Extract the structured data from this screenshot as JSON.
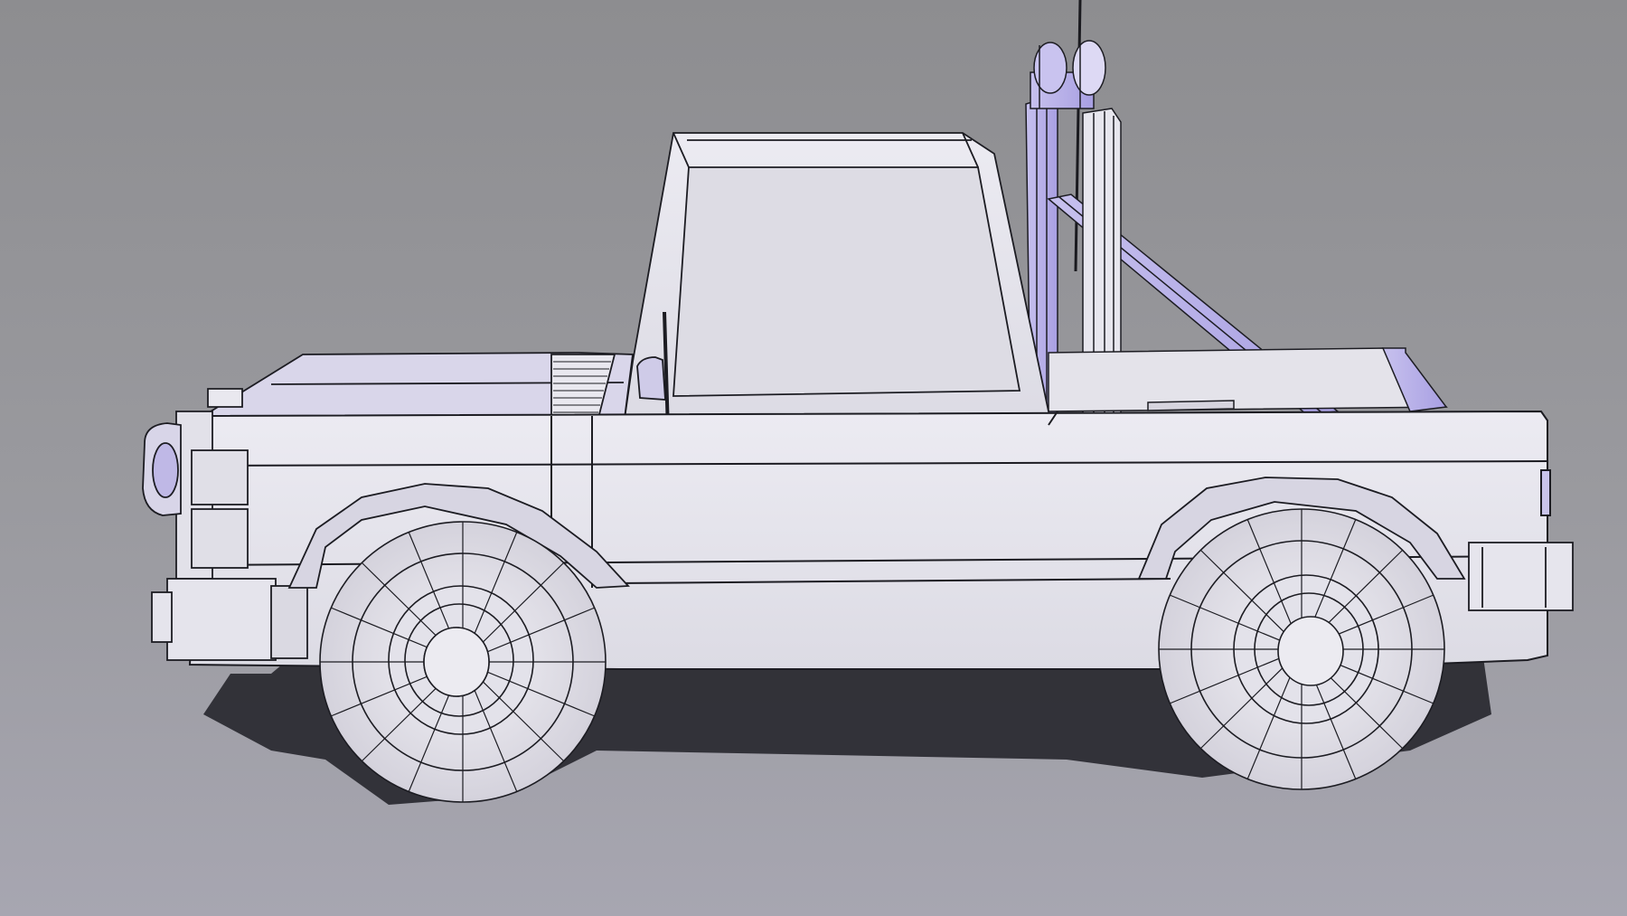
{
  "scene": {
    "subject": "pickup-truck-wireframe",
    "colors": {
      "background_top": "#8e8e92",
      "background_bottom": "#a6a5b0",
      "body_fill": "#e6e5ec",
      "body_shade": "#d2d0dc",
      "accent_violet": "#b7aee8",
      "wire": "#1c1c22",
      "shadow": "#2a2a30"
    }
  }
}
